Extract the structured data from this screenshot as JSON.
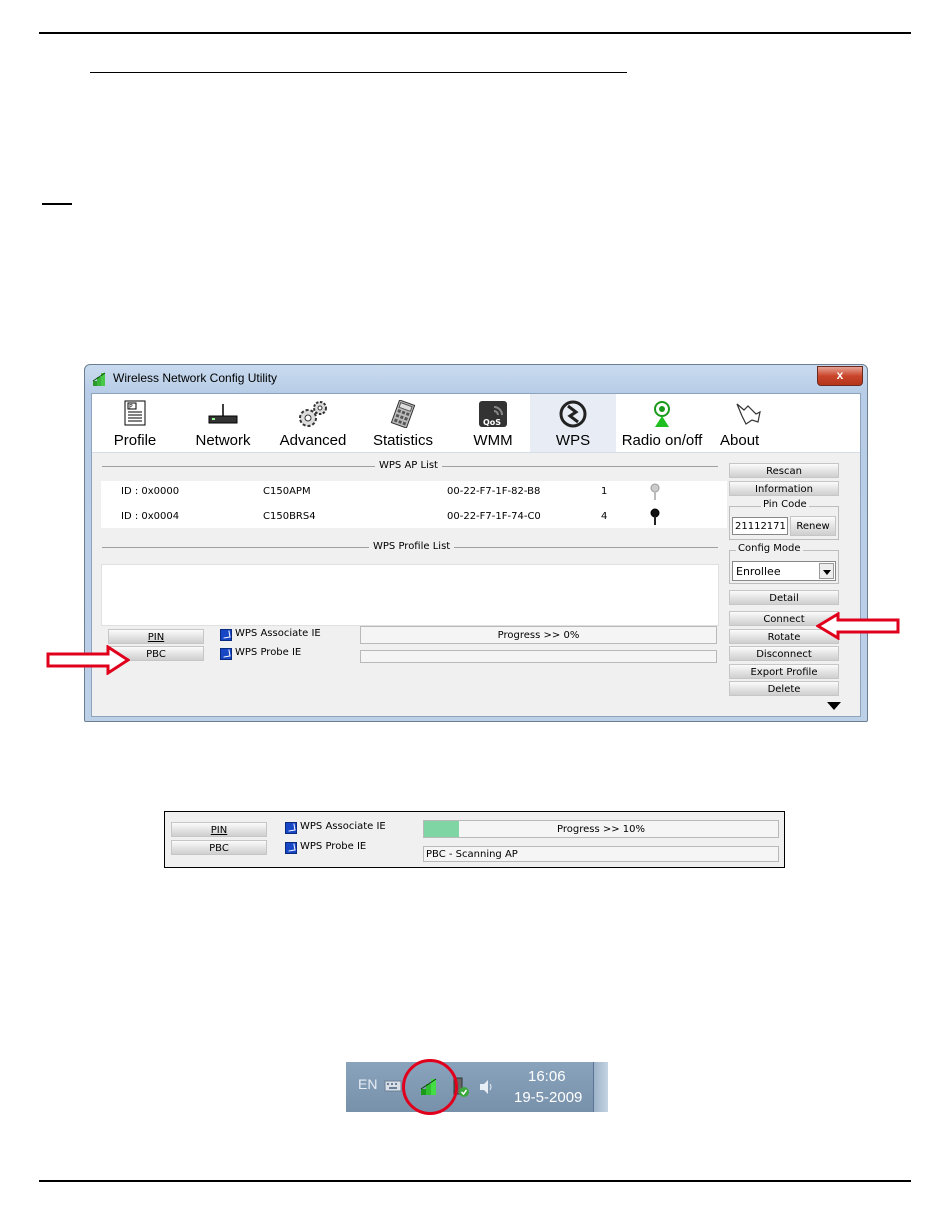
{
  "document": {
    "top_rule": "",
    "heading_underline": ""
  },
  "window": {
    "title": "Wireless Network Config Utility",
    "close_label": "x",
    "toolbar": [
      {
        "label": "Profile",
        "icon": "profile-icon"
      },
      {
        "label": "Network",
        "icon": "router-icon"
      },
      {
        "label": "Advanced",
        "icon": "gears-icon"
      },
      {
        "label": "Statistics",
        "icon": "calculator-icon"
      },
      {
        "label": "WMM",
        "icon": "qos-icon"
      },
      {
        "label": "WPS",
        "icon": "wps-icon",
        "active": true
      },
      {
        "label": "Radio on/off",
        "icon": "radio-icon"
      },
      {
        "label": "About",
        "icon": "about-icon"
      }
    ],
    "ap_list_title": "WPS AP List",
    "ap_list": [
      {
        "id": "ID : 0x0000",
        "ssid": "C150APM",
        "bssid": "00-22-F7-1F-82-B8",
        "channel": "1"
      },
      {
        "id": "ID : 0x0004",
        "ssid": "C150BRS4",
        "bssid": "00-22-F7-1F-74-C0",
        "channel": "4"
      }
    ],
    "profile_list_title": "WPS Profile List",
    "pin_button": "PIN",
    "pbc_button": "PBC",
    "wps_associate_ie": "WPS Associate IE",
    "wps_probe_ie": "WPS Probe IE",
    "progress_text": "Progress >> 0%",
    "progress_value": 0,
    "side": {
      "rescan": "Rescan",
      "information": "Information",
      "pin_code_caption": "Pin Code",
      "pin_code_value": "21112171",
      "renew": "Renew",
      "config_mode_caption": "Config Mode",
      "config_mode_value": "Enrollee",
      "detail": "Detail",
      "connect": "Connect",
      "rotate": "Rotate",
      "disconnect": "Disconnect",
      "export_profile": "Export Profile",
      "delete": "Delete"
    }
  },
  "snippet": {
    "pin_button": "PIN",
    "pbc_button": "PBC",
    "wps_associate_ie": "WPS Associate IE",
    "wps_probe_ie": "WPS Probe IE",
    "progress_text": "Progress >> 10%",
    "progress_value": 10,
    "status_text": "PBC - Scanning AP",
    "progress_color": "#7fd6a4"
  },
  "taskbar": {
    "language": "EN",
    "time": "16:06",
    "date": "19-5-2009",
    "highlight_color": "#e0001b"
  },
  "colors": {
    "arrow": "#e0001b",
    "checkbox": "#1747c4"
  }
}
